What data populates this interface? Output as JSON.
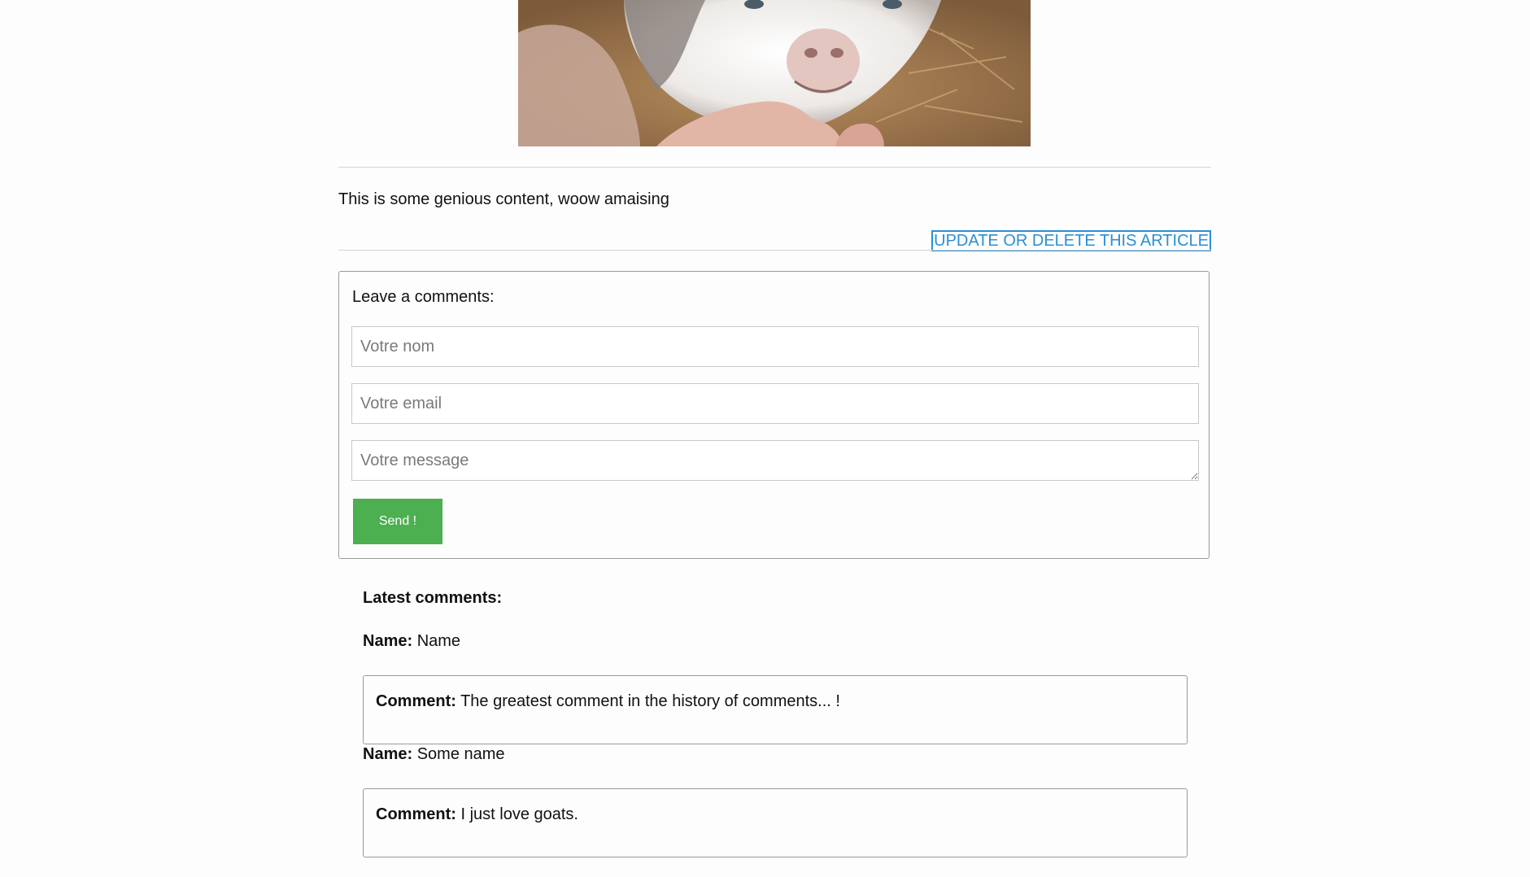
{
  "article": {
    "content": "This is some genious content, woow amaising",
    "update_link": "UPDATE OR DELETE THIS ARTICLE"
  },
  "comment_form": {
    "title": "Leave a comments:",
    "name_placeholder": "Votre nom",
    "email_placeholder": "Votre email",
    "message_placeholder": "Votre message",
    "send_label": "Send !"
  },
  "latest": {
    "title": "Latest comments:",
    "name_label": "Name:",
    "comment_label": "Comment:",
    "items": [
      {
        "name": "Name",
        "comment": "The greatest comment in the history of comments... !"
      },
      {
        "name": "Some name",
        "comment": "I just love goats."
      }
    ]
  },
  "colors": {
    "link": "#2a8fd6",
    "send_button": "#4caf50"
  }
}
